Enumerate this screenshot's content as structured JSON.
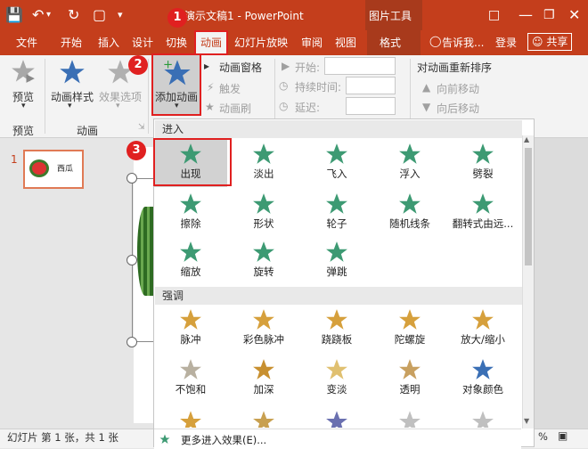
{
  "titlebar": {
    "title": "演示文稿1 - PowerPoint",
    "context_title": "图片工具",
    "icons": [
      "save-icon",
      "undo-icon",
      "repeat-icon",
      "present-icon",
      "more-icon",
      "ribbon-display-icon",
      "minimize-icon",
      "restore-icon",
      "close-icon"
    ]
  },
  "tabs": [
    "文件",
    "开始",
    "插入",
    "设计",
    "切换",
    "动画",
    "幻灯片放映",
    "审阅",
    "视图",
    "格式"
  ],
  "tellme": "告诉我...",
  "login": "登录",
  "share": "共享",
  "ribbon": {
    "preview": "预览",
    "anim_style": "动画样式",
    "effect_options": "效果选项",
    "add_anim": "添加动画",
    "anim_pane": "动画窗格",
    "trigger": "触发",
    "painter": "动画刷",
    "start": "开始:",
    "duration": "持续时间:",
    "delay": "延迟:",
    "reorder": "对动画重新排序",
    "move_earlier": "向前移动",
    "move_later": "向后移动",
    "group_preview": "预览",
    "group_anim": "动画"
  },
  "thumbnail": {
    "number": "1",
    "text": "西瓜"
  },
  "status": {
    "text": "幻灯片 第 1 张，共 1 张",
    "zoom_fragment": "%"
  },
  "dropdown": {
    "section_entrance": "进入",
    "section_emphasis": "强调",
    "entrance": [
      "出现",
      "淡出",
      "飞入",
      "浮入",
      "劈裂",
      "擦除",
      "形状",
      "轮子",
      "随机线条",
      "翻转式由远...",
      "缩放",
      "旋转",
      "弹跳"
    ],
    "emphasis": [
      "脉冲",
      "彩色脉冲",
      "跷跷板",
      "陀螺旋",
      "放大/缩小",
      "不饱和",
      "加深",
      "变淡",
      "透明",
      "对象颜色"
    ],
    "more": "更多进入效果(E)..."
  },
  "badges": [
    "1",
    "2",
    "3"
  ],
  "colors": {
    "accent": "#c43e1c",
    "star_green": "#3d9a73",
    "star_blue": "#3a6fb5",
    "star_gold": "#d6a03c",
    "highlight": "#e02020"
  }
}
